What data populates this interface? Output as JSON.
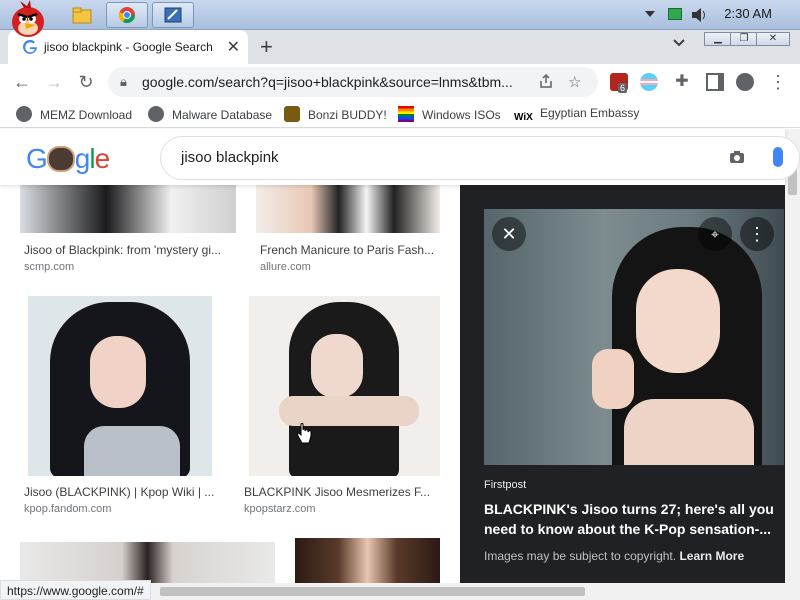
{
  "taskbar": {
    "clock": "2:30 AM"
  },
  "tab": {
    "title": "jisoo blackpink - Google Search",
    "close": "✕",
    "new_tab": "+"
  },
  "omnibox": {
    "url": "google.com/search?q=jisoo+blackpink&source=lnms&tbm..."
  },
  "extensions": {
    "badge_count": "6"
  },
  "bookmarks": [
    {
      "label": "MEMZ Download"
    },
    {
      "label": "Malware Database"
    },
    {
      "label": "Bonzi BUDDY!"
    },
    {
      "label": "Windows ISOs"
    },
    {
      "label": "Egyptian Embassy"
    }
  ],
  "google": {
    "logo": "Google",
    "query": "jisoo blackpink"
  },
  "results": [
    {
      "caption": "Jisoo of Blackpink: from 'mystery gi...",
      "source": "scmp.com"
    },
    {
      "caption": "French Manicure to Paris Fash...",
      "source": "allure.com"
    },
    {
      "caption": "Jisoo (BLACKPINK) | Kpop Wiki | ...",
      "source": "kpop.fandom.com"
    },
    {
      "caption": "BLACKPINK Jisoo Mesmerizes F...",
      "source": "kpopstarz.com"
    }
  ],
  "panel": {
    "source": "Firstpost",
    "title": "BLACKPINK's Jisoo turns 27; here's all you need to know about the K-Pop sensation-...",
    "copyright": "Images may be subject to copyright.",
    "learn_more": "Learn More"
  },
  "status_url": "https://www.google.com/#",
  "colors": {
    "google_blue": "#4285f4",
    "panel_bg": "#202124",
    "chrome_frame": "#dee1e6"
  }
}
